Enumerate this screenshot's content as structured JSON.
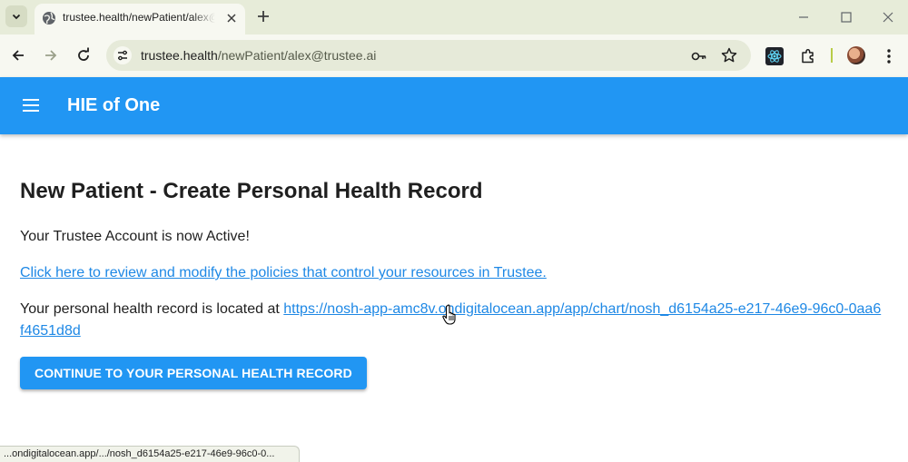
{
  "browser": {
    "tab": {
      "title": "trustee.health/newPatient/alex@",
      "favicon": "globe-icon"
    },
    "url": {
      "host": "trustee.health",
      "path": "/newPatient/alex@trustee.ai"
    },
    "status_bar": "...ondigitalocean.app/.../nosh_d6154a25-e217-46e9-96c0-0..."
  },
  "app": {
    "title": "HIE of One"
  },
  "page": {
    "heading": "New Patient - Create Personal Health Record",
    "account_status": "Your Trustee Account is now Active!",
    "policies_link": "Click here to review and modify the policies that control your resources in Trustee.",
    "record_prefix": "Your personal health record is located at ",
    "record_link": "https://nosh-app-amc8v.ondigitalocean.app/app/chart/nosh_d6154a25-e217-46e9-96c0-0aa6f4651d8d",
    "continue_button": "CONTINUE TO YOUR PERSONAL HEALTH RECORD"
  },
  "colors": {
    "app_bar": "#2196f3",
    "link": "#1e88e5",
    "browser_frame": "#e7ecd9"
  }
}
